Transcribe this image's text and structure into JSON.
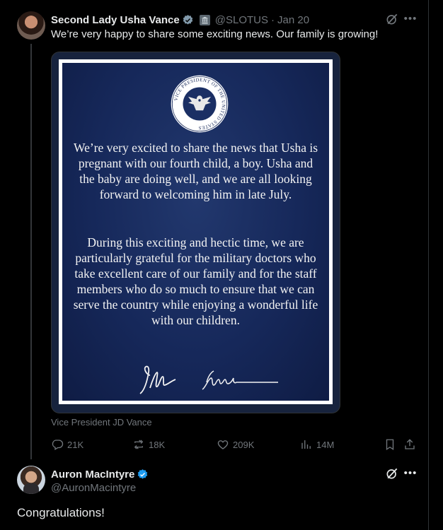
{
  "tweet": {
    "author_name": "Second Lady Usha Vance",
    "handle": "@SLOTUS",
    "separator": "·",
    "date": "Jan 20",
    "text": "We’re very happy to share some exciting news. Our family is growing!",
    "media": {
      "paragraph1": "We’re very excited to share the news that Usha is pregnant with our fourth child, a boy. Usha and the baby are doing well, and we are all looking forward to welcoming him in late July.",
      "paragraph2": "During this exciting and hectic time, we are particularly grateful for the military doctors who take excellent care of our family and for the staff members who do so much to ensure that we can serve the country while enjoying a wonderful life with our children.",
      "seal_text": "VICE PRESIDENT OF THE UNITED STATES",
      "caption": "Vice President JD Vance"
    },
    "actions": {
      "replies": "21K",
      "reposts": "18K",
      "likes": "209K",
      "views": "14M"
    }
  },
  "reply": {
    "author_name": "Auron MacIntyre",
    "handle": "@AuronMacintyre",
    "text": "Congratulations!"
  },
  "icons": {
    "verified": "verified-badge-icon",
    "government": "government-affiliation-icon",
    "grok": "grok-icon",
    "more": "more-icon",
    "reply": "reply-icon",
    "repost": "repost-icon",
    "like": "heart-icon",
    "views": "views-icon",
    "bookmark": "bookmark-icon",
    "share": "share-icon"
  },
  "colors": {
    "background": "#000000",
    "text": "#e7e9ea",
    "muted": "#71767b",
    "verified_gray": "#829aab",
    "verified_blue": "#1d9bf0",
    "poster_navy": "#16285a"
  }
}
